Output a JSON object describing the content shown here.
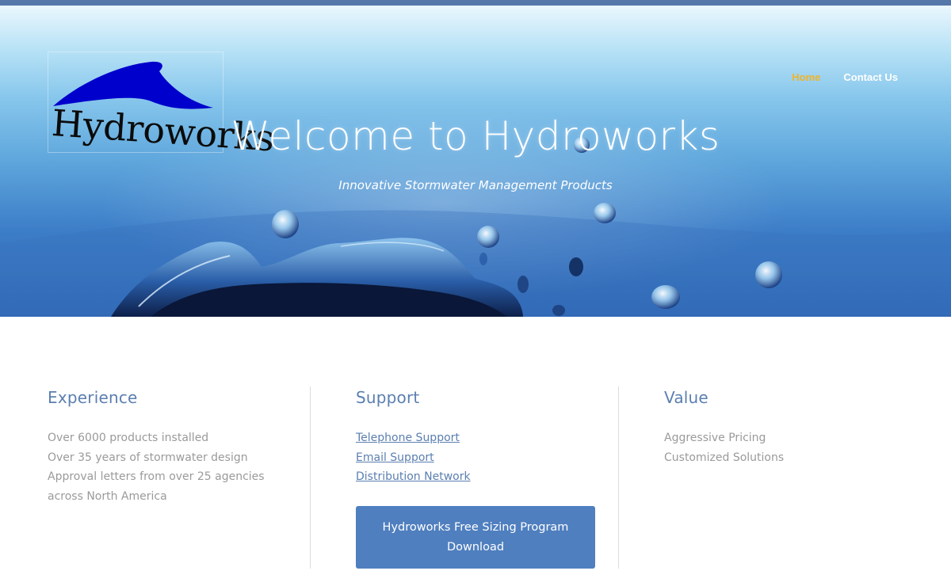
{
  "brand": {
    "logo_text": "Hydroworks",
    "logo_wave_color": "#0000cc"
  },
  "nav": {
    "items": [
      {
        "label": "Home",
        "active": true
      },
      {
        "label": "Contact Us",
        "active": false
      }
    ]
  },
  "hero": {
    "title": "Welcome to Hydroworks",
    "subtitle": "Innovative Stormwater Management Products"
  },
  "columns": {
    "experience": {
      "heading": "Experience",
      "lines": [
        "Over 6000 products installed",
        "Over 35 years of stormwater design",
        "Approval letters from over 25 agencies",
        "across North America"
      ]
    },
    "support": {
      "heading": "Support",
      "links": [
        "Telephone Support",
        "Email Support",
        "Distribution Network"
      ],
      "download_button": "Hydroworks Free Sizing Program Download"
    },
    "value": {
      "heading": "Value",
      "lines": [
        "Aggressive Pricing",
        "Customized Solutions"
      ]
    }
  },
  "colors": {
    "accent": "#5b7fb0",
    "nav_active": "#f0b429",
    "button": "#4f7fbf",
    "top_bar": "#5577aa"
  }
}
